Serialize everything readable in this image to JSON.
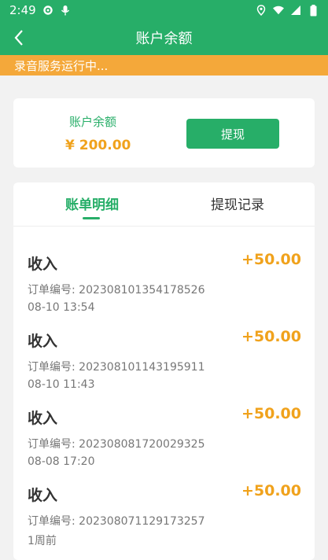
{
  "status_bar": {
    "time": "2:49"
  },
  "header": {
    "title": "账户余额"
  },
  "banner": {
    "text": "录音服务运行中..."
  },
  "balance": {
    "label": "账户余额",
    "amount": "¥ 200.00",
    "withdraw_label": "提现"
  },
  "tabs": [
    {
      "label": "账单明细",
      "active": true
    },
    {
      "label": "提现记录",
      "active": false
    }
  ],
  "records": [
    {
      "type": "收入",
      "amount": "+50.00",
      "order": "订单编号: 202308101354178526",
      "time": "08-10 13:54"
    },
    {
      "type": "收入",
      "amount": "+50.00",
      "order": "订单编号: 202308101143195911",
      "time": "08-10 11:43"
    },
    {
      "type": "收入",
      "amount": "+50.00",
      "order": "订单编号: 202308081720029325",
      "time": "08-08 17:20"
    },
    {
      "type": "收入",
      "amount": "+50.00",
      "order": "订单编号: 202308071129173257",
      "time": "1周前"
    }
  ],
  "colors": {
    "primary": "#27ae68",
    "banner": "#f4a83a",
    "amount": "#f0a21c"
  }
}
